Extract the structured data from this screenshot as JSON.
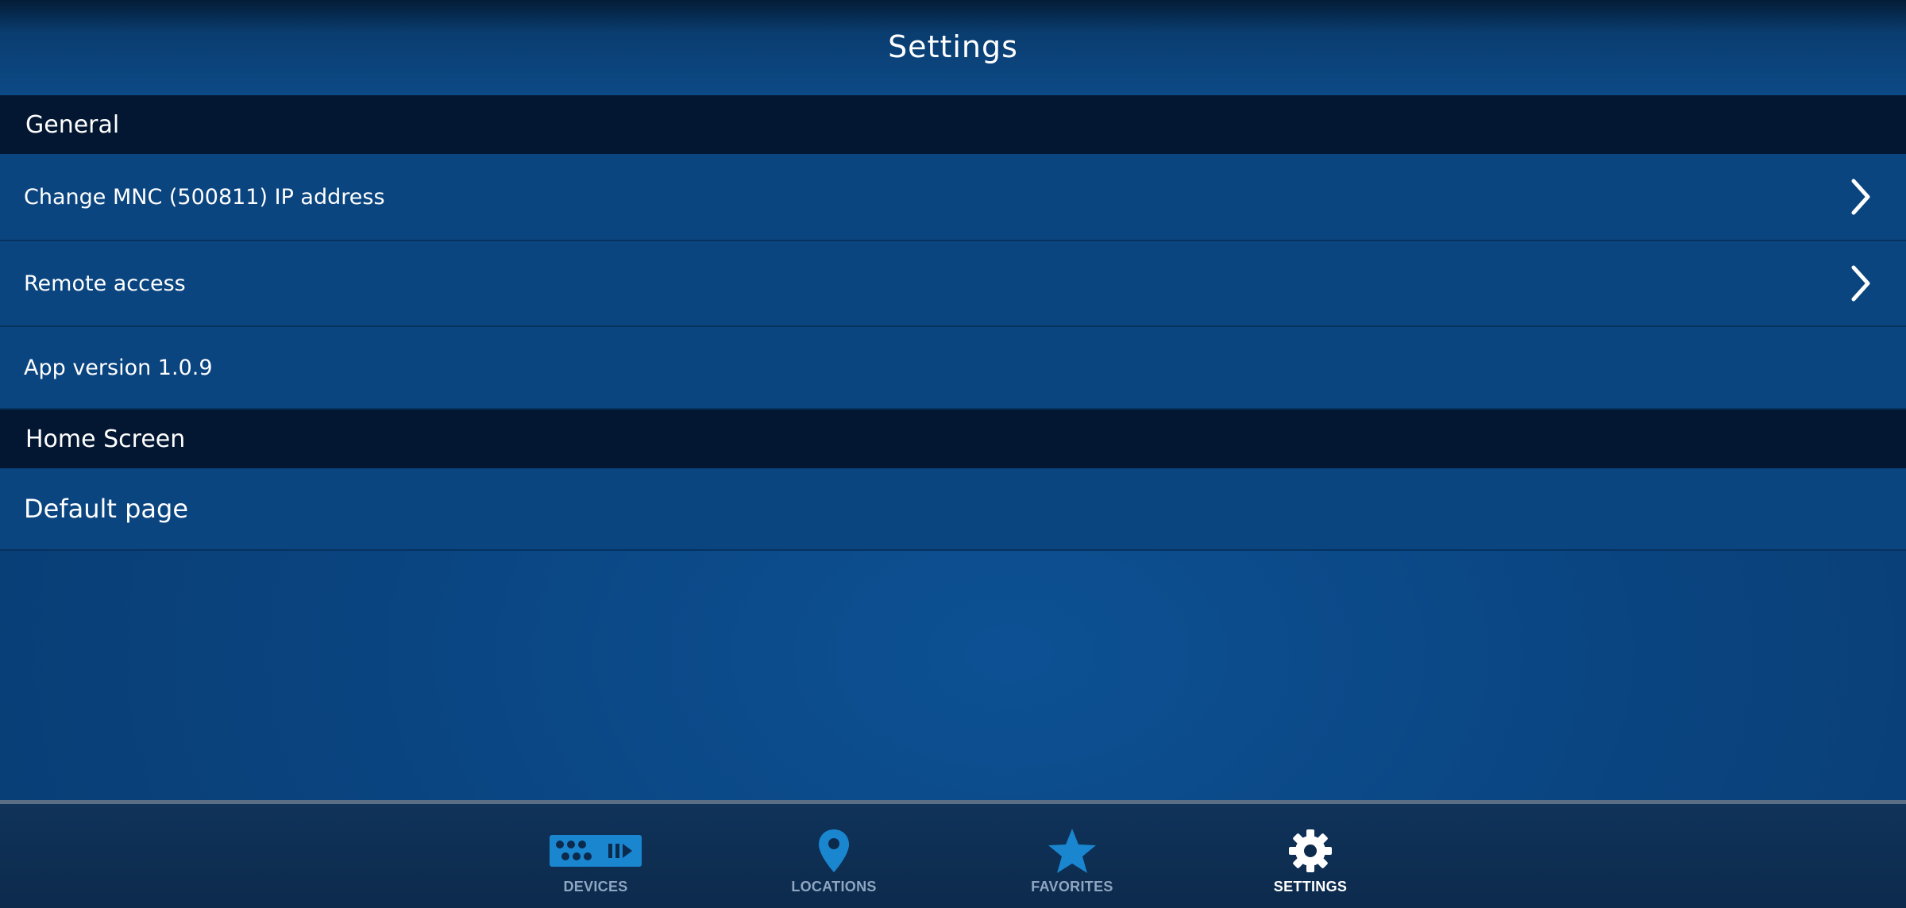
{
  "header": {
    "title": "Settings"
  },
  "sections": {
    "general": {
      "title": "General",
      "rows": [
        {
          "label": "Change MNC (500811) IP address"
        },
        {
          "label": "Remote access"
        },
        {
          "label": "App version 1.0.9"
        }
      ]
    },
    "home_screen": {
      "title": "Home Screen",
      "rows": [
        {
          "label": "Default page"
        }
      ]
    }
  },
  "tabbar": {
    "tabs": [
      {
        "label": "DEVICES",
        "icon": "devices-icon",
        "active": false
      },
      {
        "label": "LOCATIONS",
        "icon": "location-pin-icon",
        "active": false
      },
      {
        "label": "FAVORITES",
        "icon": "star-icon",
        "active": false
      },
      {
        "label": "SETTINGS",
        "icon": "gear-icon",
        "active": true
      }
    ]
  },
  "colors": {
    "accent": "#1a86d0",
    "section_header_bg": "#031732",
    "row_bg": "#0b4580",
    "active_tab_label": "#ffffff",
    "inactive_tab_label": "#8fa6c2"
  }
}
